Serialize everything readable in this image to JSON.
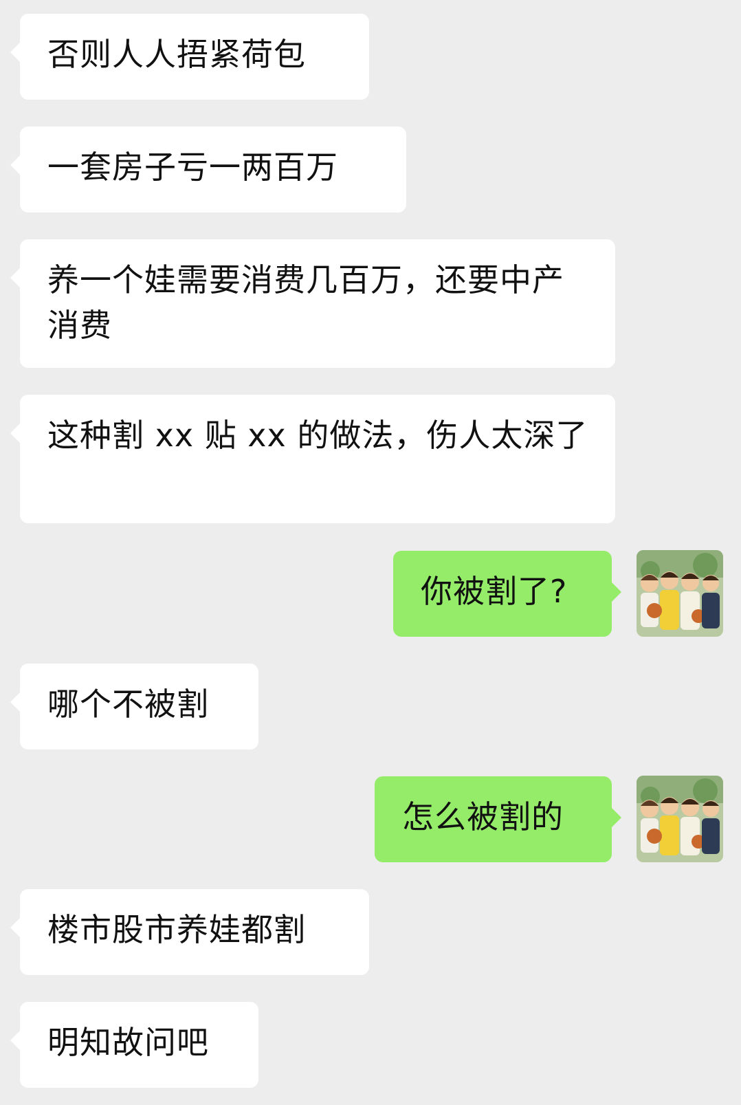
{
  "messages": [
    {
      "side": "in",
      "text": "否则人人捂紧荷包"
    },
    {
      "side": "in",
      "text": "一套房子亏一两百万"
    },
    {
      "side": "in",
      "text": "养一个娃需要消费几百万，还要中产消费"
    },
    {
      "side": "in",
      "text": "这种割 xx 贴 xx 的做法，伤人太深了"
    },
    {
      "side": "out",
      "text": "你被割了?",
      "avatar": "cartoon-basketball-boys-avatar"
    },
    {
      "side": "in",
      "text": "哪个不被割"
    },
    {
      "side": "out",
      "text": "怎么被割的",
      "avatar": "cartoon-basketball-boys-avatar"
    },
    {
      "side": "in",
      "text": "楼市股市养娃都割"
    },
    {
      "side": "in",
      "text": "明知故问吧"
    }
  ],
  "colors": {
    "background": "#ededed",
    "incoming_bubble": "#ffffff",
    "outgoing_bubble": "#95ec69",
    "text": "#111111"
  }
}
